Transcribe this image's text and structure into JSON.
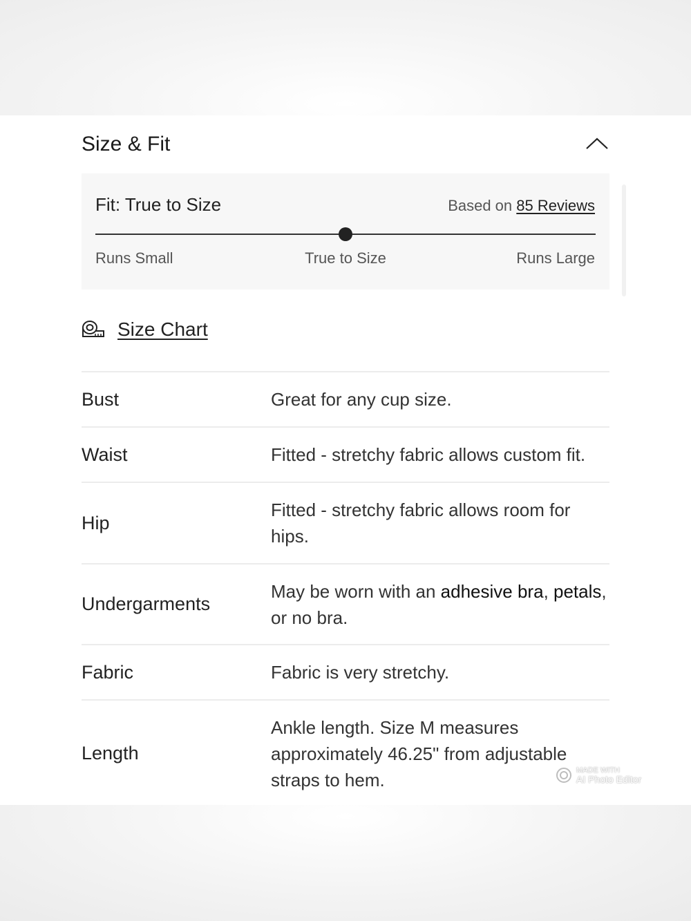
{
  "section": {
    "title": "Size & Fit",
    "collapse_icon": "chevron-up-icon"
  },
  "fit": {
    "label": "Fit: True to Size",
    "based_on": "Based on",
    "reviews_link": "85 Reviews",
    "scale_labels": [
      "Runs Small",
      "True to Size",
      "Runs Large"
    ],
    "indicator_fraction": 0.5
  },
  "size_chart": {
    "icon": "measuring-tape-icon",
    "label": "Size Chart"
  },
  "specs": [
    {
      "label": "Bust",
      "value": "Great for any cup size."
    },
    {
      "label": "Waist",
      "value": "Fitted - stretchy fabric allows custom fit."
    },
    {
      "label": "Hip",
      "value": "Fitted - stretchy fabric allows room for hips."
    },
    {
      "label": "Undergarments",
      "value_parts": [
        "May be worn with an ",
        "adhesive bra",
        ", ",
        "petals",
        ", or no bra."
      ]
    },
    {
      "label": "Fabric",
      "value": "Fabric is very stretchy."
    },
    {
      "label": "Length",
      "value": "Ankle length. Size M measures approximately 46.25\" from adjustable straps to hem."
    }
  ],
  "watermark": {
    "line1": "MADE WITH",
    "line2": "AI Photo Editor"
  },
  "colors": {
    "text": "#222222",
    "muted": "#555555",
    "fit_box_bg": "#f7f7f7",
    "divider": "#ececec"
  }
}
